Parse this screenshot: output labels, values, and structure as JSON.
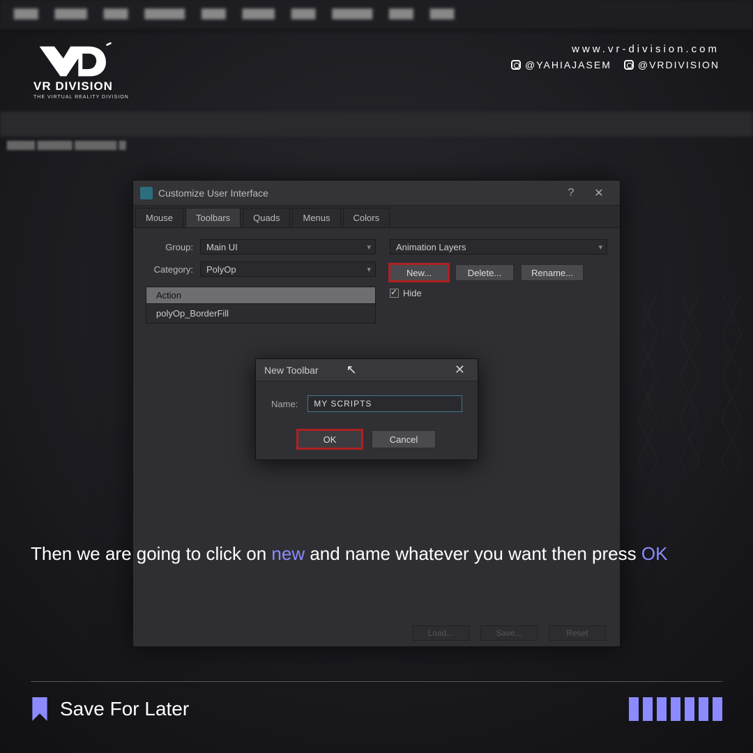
{
  "branding": {
    "name": "VR DIVISION",
    "tagline": "THE VIRTUAL REALITY DIVISION",
    "url": "www.vr-division.com",
    "handle1": "@YAHIAJASEM",
    "handle2": "@VRDIVISION"
  },
  "cui": {
    "title": "Customize User Interface",
    "tabs": [
      "Mouse",
      "Toolbars",
      "Quads",
      "Menus",
      "Colors"
    ],
    "active_tab": 1,
    "group_label": "Group:",
    "group_value": "Main UI",
    "category_label": "Category:",
    "category_value": "PolyOp",
    "action_header": "Action",
    "action_items": [
      "polyOp_BorderFill"
    ],
    "right_dd": "Animation Layers",
    "new_btn": "New...",
    "delete_btn": "Delete...",
    "rename_btn": "Rename...",
    "hide_label": "Hide",
    "load_btn": "Load...",
    "save_btn": "Save...",
    "reset_btn": "Reset"
  },
  "nt": {
    "title": "New Toolbar",
    "name_label": "Name:",
    "name_value": "MY SCRIPTS",
    "ok": "OK",
    "cancel": "Cancel"
  },
  "instruction": {
    "pre": "Then we are going to click on ",
    "hl1": "new",
    "mid": " and name whatever you want then press ",
    "hl2": "OK"
  },
  "footer": {
    "text": "Save For Later"
  }
}
